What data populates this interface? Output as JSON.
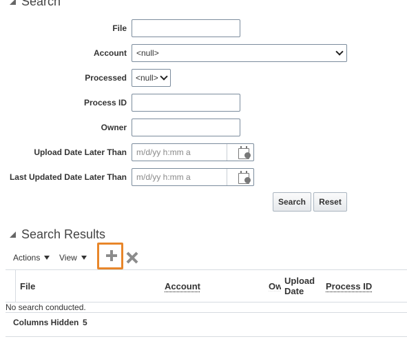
{
  "search_section": {
    "title": "Search"
  },
  "fields": {
    "file": {
      "label": "File",
      "value": ""
    },
    "account": {
      "label": "Account",
      "value": "<null>"
    },
    "processed": {
      "label": "Processed",
      "value": "<null>"
    },
    "process_id": {
      "label": "Process ID",
      "value": ""
    },
    "owner": {
      "label": "Owner",
      "value": ""
    },
    "upload_date": {
      "label": "Upload Date Later Than",
      "placeholder": "m/d/yy h:mm a"
    },
    "last_updated": {
      "label": "Last Updated Date Later Than",
      "placeholder": "m/d/yy h:mm a"
    }
  },
  "buttons": {
    "search": "Search",
    "reset": "Reset"
  },
  "results_section": {
    "title": "Search Results"
  },
  "toolbar": {
    "actions": "Actions",
    "view": "View"
  },
  "table": {
    "columns": [
      "File",
      "Account",
      "Ow",
      "Upload Date",
      "Process ID"
    ],
    "empty_message": "No search conducted.",
    "columns_hidden_label": "Columns Hidden",
    "columns_hidden_count": "5"
  },
  "colors": {
    "highlight": "#e8862a",
    "icon_gray": "#8c8c8c"
  }
}
